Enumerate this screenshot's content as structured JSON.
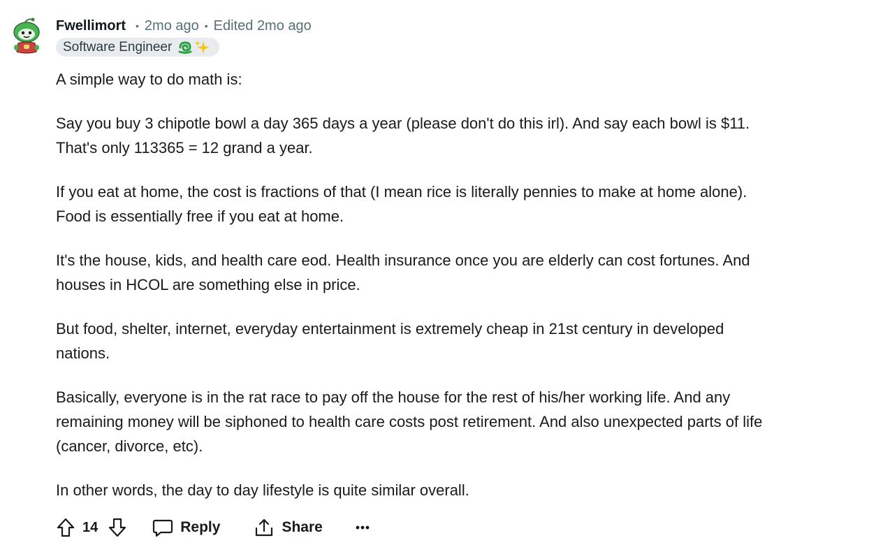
{
  "comment": {
    "author": "Fwellimort",
    "separator": "•",
    "posted_ago": "2mo ago",
    "edited": "Edited 2mo ago",
    "flair": {
      "text": "Software Engineer",
      "emojis": [
        "green-swirl-icon",
        "sparkles-icon"
      ]
    },
    "paragraphs": [
      "A simple way to do math is:",
      "Say you buy 3 chipotle bowl a day 365 days a year (please don't do this irl). And say each bowl is $11.\nThat's only 113365 = 12 grand a year.",
      "If you eat at home, the cost is fractions of that (I mean rice is literally pennies to make at home alone).\nFood is essentially free if you eat at home.",
      "It's the house, kids, and health care eod. Health insurance once you are elderly can cost fortunes. And\nhouses in HCOL are something else in price.",
      "But food, shelter, internet, everyday entertainment is extremely cheap in 21st century in developed\nnations.",
      "Basically, everyone is in the rat race to pay off the house for the rest of his/her working life. And any\nremaining money will be siphoned to health care costs post retirement. And also unexpected parts of life\n(cancer, divorce, etc).",
      "In other words, the day to day lifestyle is quite similar overall."
    ],
    "actions": {
      "upvote_icon": "arrow-up-icon",
      "vote_count": "14",
      "downvote_icon": "arrow-down-icon",
      "reply_label": "Reply",
      "share_label": "Share",
      "more_icon": "more-dots-icon"
    }
  },
  "colors": {
    "meta_text": "#576f76",
    "flair_bg": "#e9ecef",
    "avatar_green": "#3fae49"
  }
}
